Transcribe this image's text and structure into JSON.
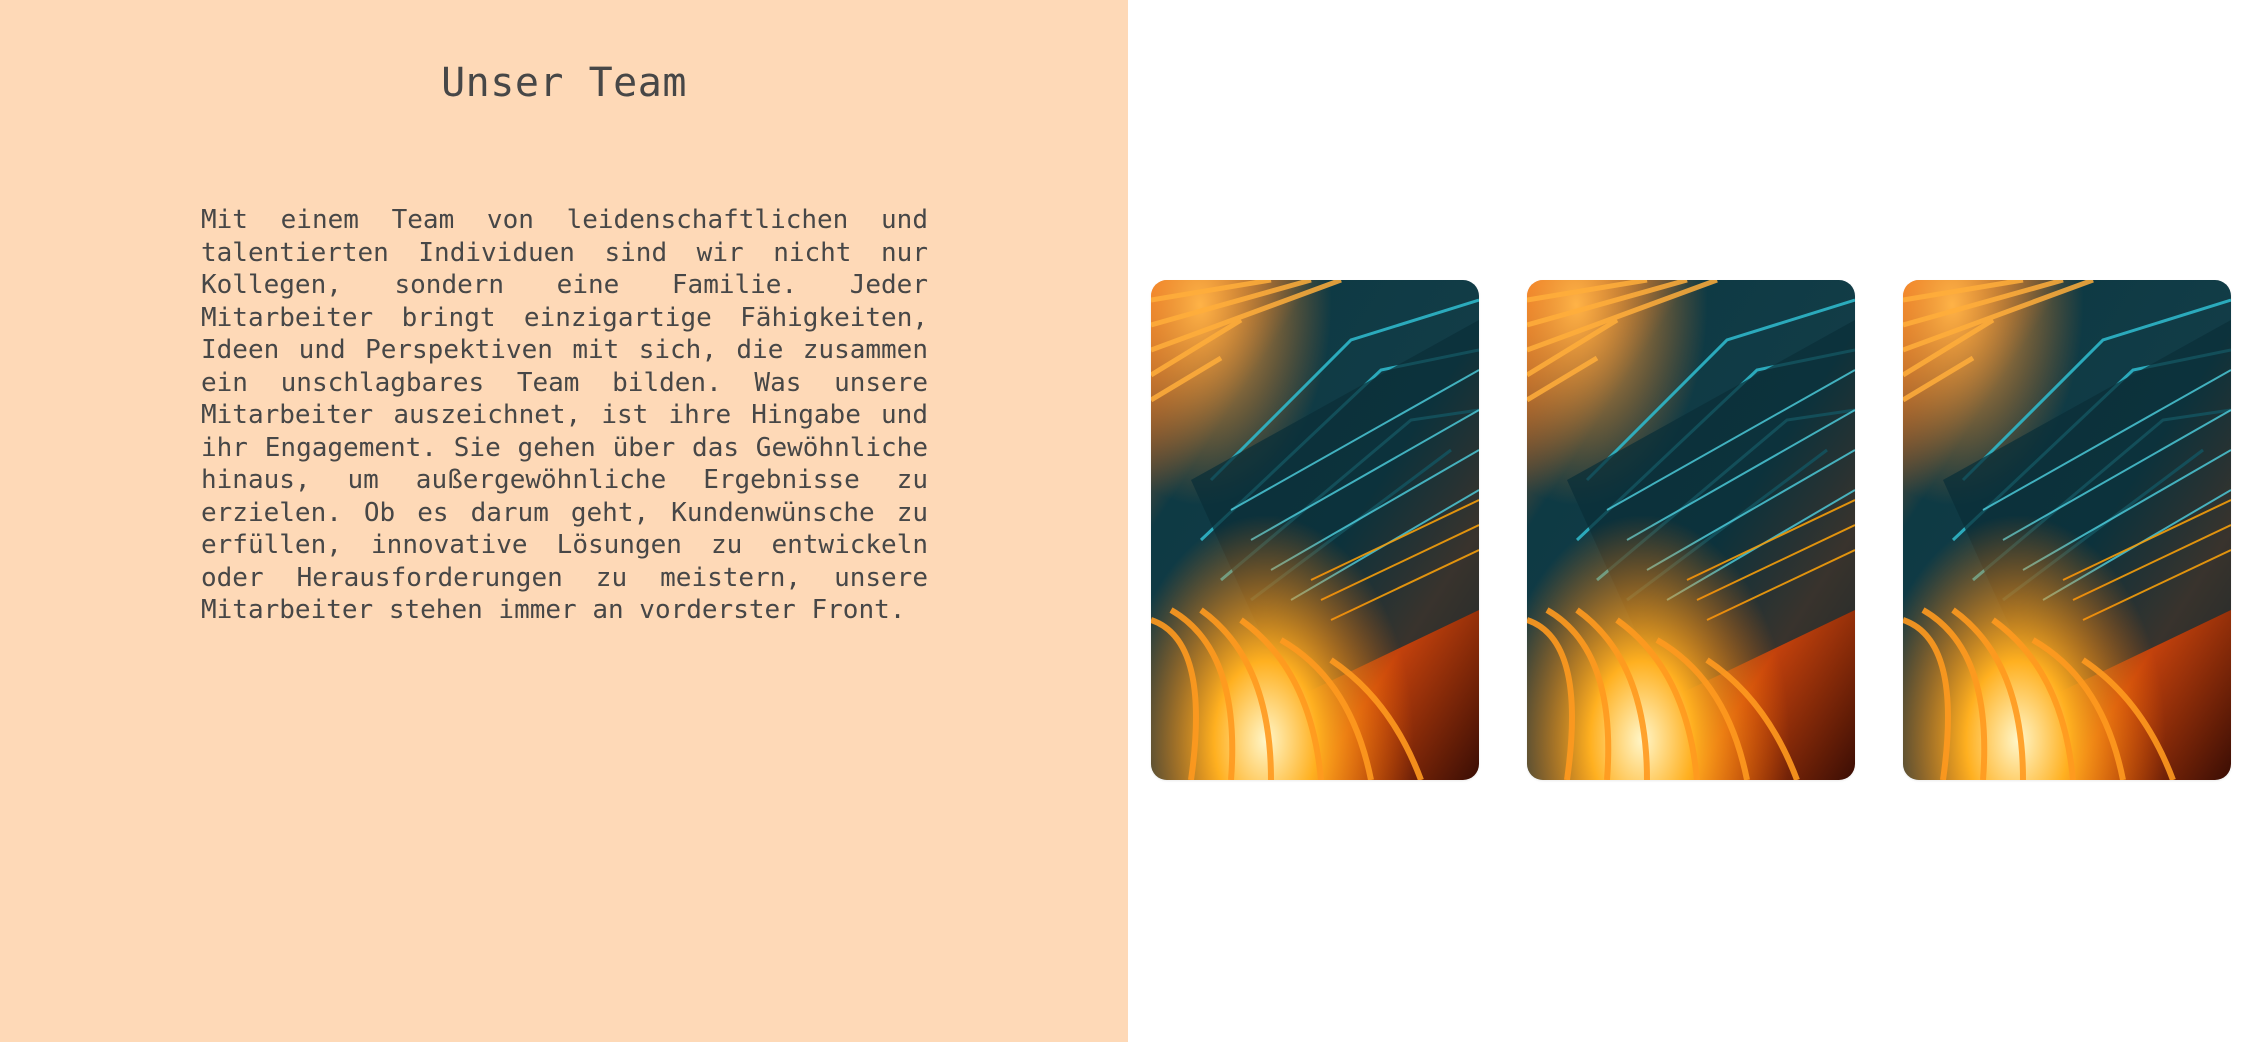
{
  "section": {
    "title": "Unser Team",
    "paragraph": "Mit einem Team von leidenschaftlichen und talentierten Individuen sind wir nicht nur Kollegen, sondern eine Familie. Jeder Mitarbeiter bringt einzigartige Fähigkeiten, Ideen und Perspektiven mit sich, die zusammen ein unschlagbares Team bilden. Was unsere Mitarbeiter auszeichnet, ist ihre Hingabe und ihr Engagement. Sie gehen über das Gewöhnliche hinaus, um außergewöhnliche Ergebnisse zu erzielen. Ob es darum geht, Kundenwünsche zu erfüllen, innovative Lösungen zu entwickeln oder Herausforderungen zu meistern, unsere Mitarbeiter stehen immer an vorderster Front."
  },
  "colors": {
    "left_background": "#fed9b7",
    "text": "#474747",
    "right_background": "#ffffff"
  },
  "gallery": {
    "images": [
      {
        "subject": "circuit-board-image"
      },
      {
        "subject": "circuit-board-image"
      },
      {
        "subject": "circuit-board-image"
      }
    ]
  }
}
